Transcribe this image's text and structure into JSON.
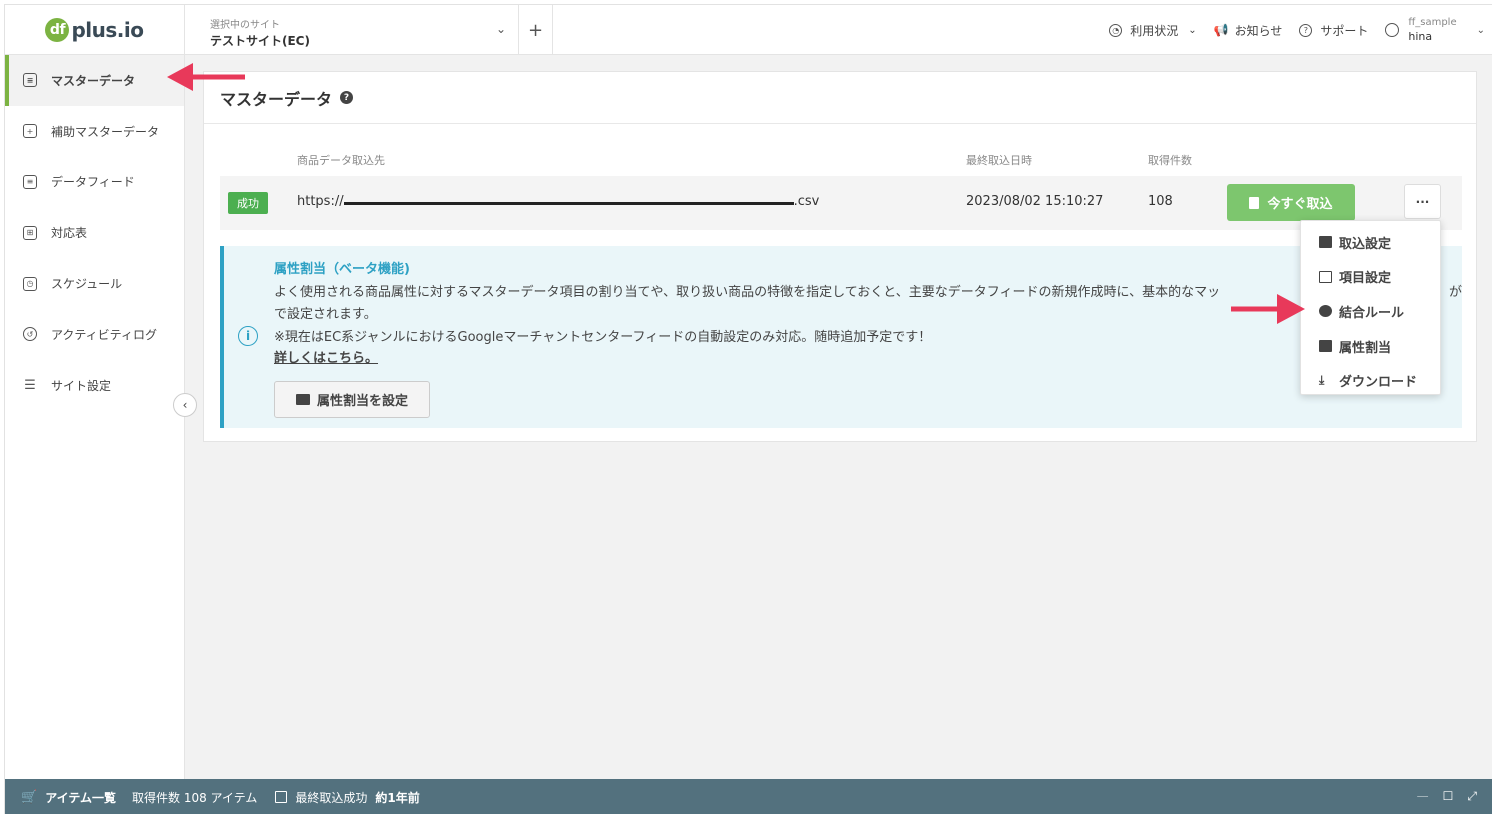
{
  "header": {
    "logo_text": "plus.io",
    "logo_mark": "df",
    "site_label": "選択中のサイト",
    "site_name": "テストサイト(EC)",
    "add_label": "+",
    "usage": "利用状況",
    "notice": "お知らせ",
    "support": "サポート",
    "user_id": "ff_sample",
    "user_name": "hina"
  },
  "sidebar": {
    "items": [
      {
        "label": "マスターデータ",
        "icon": "database-icon"
      },
      {
        "label": "補助マスターデータ",
        "icon": "database-plus-icon"
      },
      {
        "label": "データフィード",
        "icon": "file-icon"
      },
      {
        "label": "対応表",
        "icon": "table-icon"
      },
      {
        "label": "スケジュール",
        "icon": "calendar-icon"
      },
      {
        "label": "アクティビティログ",
        "icon": "history-icon"
      },
      {
        "label": "サイト設定",
        "icon": "sliders-icon"
      }
    ]
  },
  "main": {
    "title": "マスターデータ",
    "columns": {
      "source": "商品データ取込先",
      "last_import": "最終取込日時",
      "count": "取得件数"
    },
    "row": {
      "status": "成功",
      "url_prefix": "https://",
      "url_suffix": ".csv",
      "date": "2023/08/02 15:10:27",
      "count": "108",
      "import_button": "今すぐ取込",
      "more_button": "···"
    },
    "info": {
      "title": "属性割当（ベータ機能)",
      "line1": "よく使用される商品属性に対するマスターデータ項目の割り当てや、取り扱い商品の特徴を指定しておくと、主要なデータフィードの新規作成時に、基本的なマッ",
      "line1_end": "が",
      "line2": "で設定されます。",
      "line3": "※現在はEC系ジャンルにおけるGoogleマーチャントセンターフィードの自動設定のみ対応。随時追加予定です！",
      "link": "詳しくはこちら。",
      "button": "属性割当を設定"
    }
  },
  "dropdown": {
    "items": [
      {
        "label": "取込設定",
        "icon": "folder-import-icon"
      },
      {
        "label": "項目設定",
        "icon": "grid-icon"
      },
      {
        "label": "結合ルール",
        "icon": "merge-icon"
      },
      {
        "label": "属性割当",
        "icon": "folder-icon"
      },
      {
        "label": "ダウンロード",
        "icon": "download-icon"
      }
    ]
  },
  "statusbar": {
    "items_label": "アイテム一覧",
    "count_text": "取得件数 108 アイテム",
    "last_label": "最終取込成功",
    "last_value": "約1年前"
  },
  "colors": {
    "accent_green": "#7cb342",
    "button_green": "#7dc66e",
    "info_blue": "#2ea1c4",
    "arrow_red": "#e8395a",
    "statusbar": "#53717e"
  }
}
